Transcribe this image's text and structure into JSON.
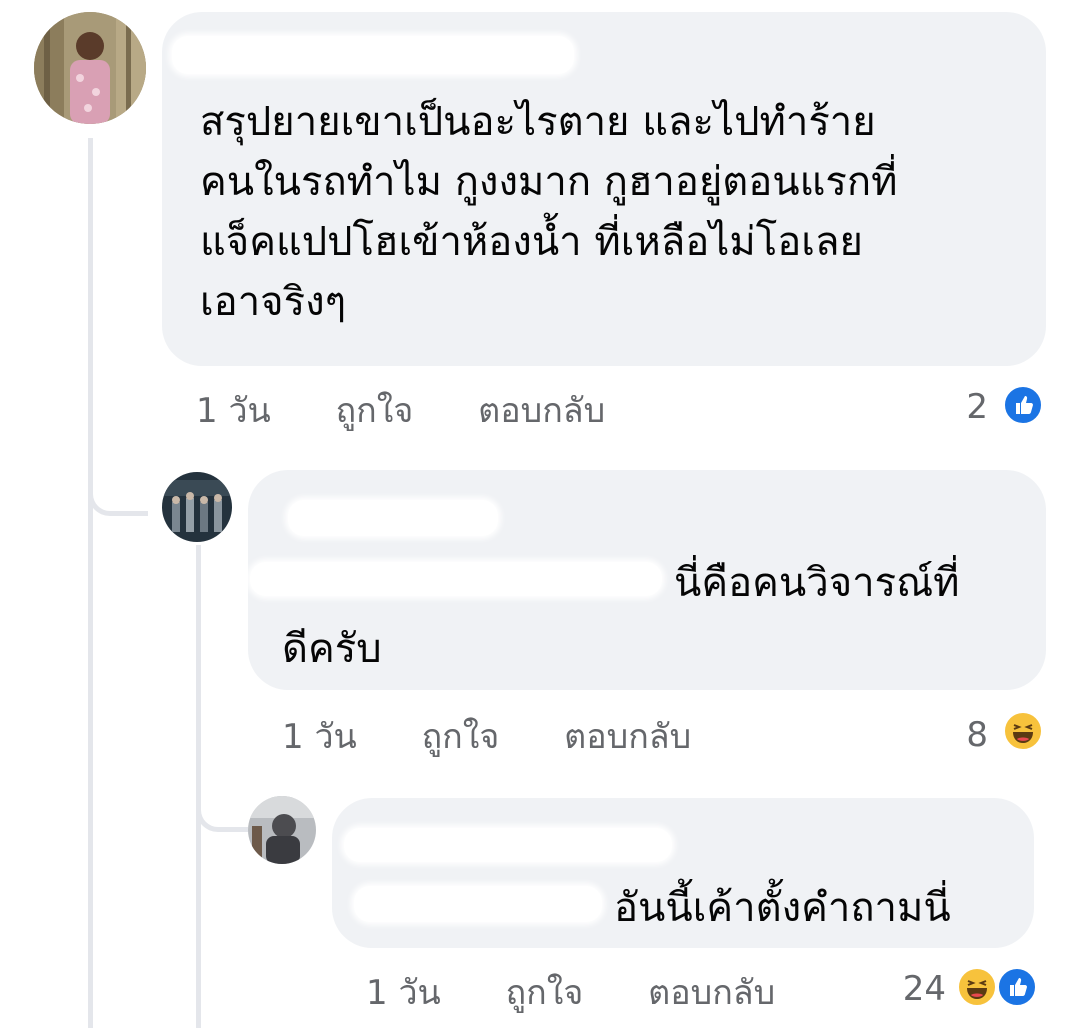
{
  "comments": [
    {
      "author": "",
      "text": "สรุปยายเขาเป็นอะไรตาย และไปทำร้าย\nคนในรถทำไม กูงงมาก กูฮาอยู่ตอนแรกที่\nแจ็คแปปโฮเข้าห้องน้ำ ที่เหลือไม่โอเลย\nเอาจริงๆ",
      "time": "1 วัน",
      "like_label": "ถูกใจ",
      "reply_label": "ตอบกลับ",
      "reaction_count": "2",
      "reactions": [
        "like-icon"
      ]
    },
    {
      "author": "",
      "mention": "",
      "text": "นี่คือคนวิจารณ์ที่",
      "text_line2": "ดีครับ",
      "time": "1 วัน",
      "like_label": "ถูกใจ",
      "reply_label": "ตอบกลับ",
      "reaction_count": "8",
      "reactions": [
        "haha-icon"
      ]
    },
    {
      "author": "",
      "mention": "",
      "text": "อันนี้เค้าตั้งคำถามนี่",
      "time": "1 วัน",
      "like_label": "ถูกใจ",
      "reply_label": "ตอบกลับ",
      "reaction_count": "24",
      "reactions": [
        "haha-icon",
        "like-icon"
      ]
    }
  ],
  "colors": {
    "bubble": "#f0f2f5",
    "meta": "#65676b",
    "mention": "#216fdb",
    "like": "#1b74e4",
    "haha": "#f7c23c"
  }
}
